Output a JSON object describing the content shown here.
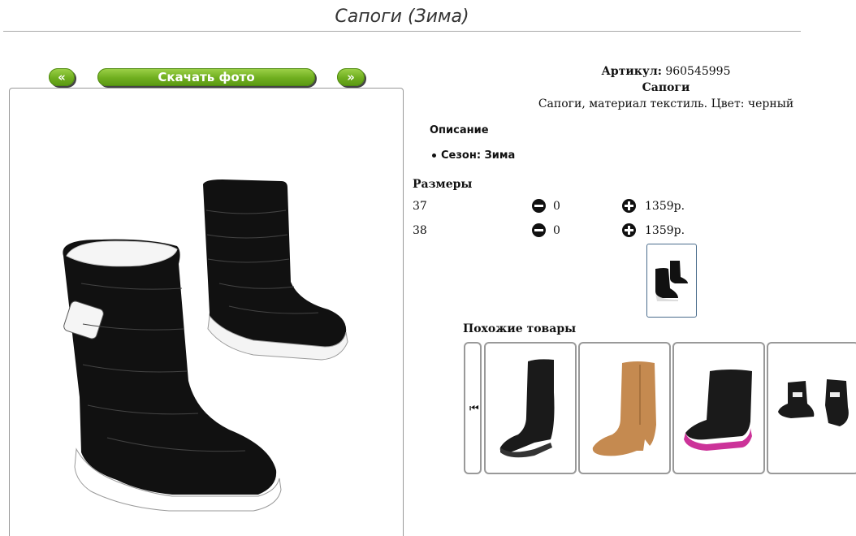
{
  "page": {
    "title": "Сапоги (Зима)"
  },
  "gallery": {
    "prev_label": "«",
    "download_label": "Скачать фото",
    "next_label": "»"
  },
  "product": {
    "article_label": "Артикул:",
    "article_value": "960545995",
    "name": "Сапоги",
    "description": "Сапоги, материал текстиль. Цвет: черный",
    "description_heading": "Описание",
    "season": "Сезон: Зима",
    "colors": {
      "boot": "#111111",
      "sole": "#ffffff",
      "lining": "#f2f2f2"
    }
  },
  "sizes": {
    "heading": "Размеры",
    "rows": [
      {
        "size": "37",
        "qty": "0",
        "price": "1359р."
      },
      {
        "size": "38",
        "qty": "0",
        "price": "1359р."
      }
    ]
  },
  "similar": {
    "heading": "Похожие товары",
    "first_icon": "⏮"
  },
  "theme": {
    "accent": "#6fae1f",
    "border": "#999999",
    "thumb_border": "#4a6c8c"
  }
}
